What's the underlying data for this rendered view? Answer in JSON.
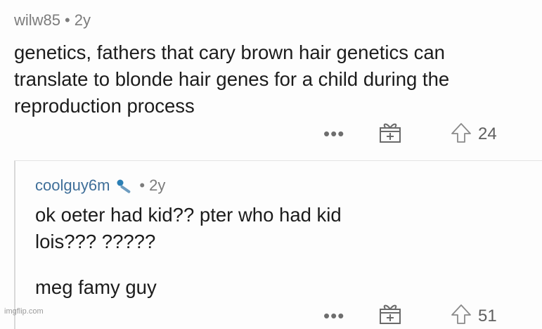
{
  "comment": {
    "username": "wilw85",
    "separator": "•",
    "age": "2y",
    "lines": [
      "genetics, fathers that cary brown hair genetics can",
      "translate to blonde hair genes for a child during the",
      "reproduction process"
    ],
    "more_label": "•••",
    "score": "24"
  },
  "reply": {
    "username": "coolguy6m",
    "separator": "•",
    "age": "2y",
    "lines": [
      "ok oeter had kid?? pter who had kid",
      "lois??? ?????"
    ],
    "last_line": "meg famy guy",
    "more_label": "•••",
    "score": "51"
  },
  "watermark": "imgflip.com",
  "icons": {
    "gift": "gift-award-icon",
    "upvote": "upvote-arrow-icon",
    "mic": "microphone-icon"
  }
}
